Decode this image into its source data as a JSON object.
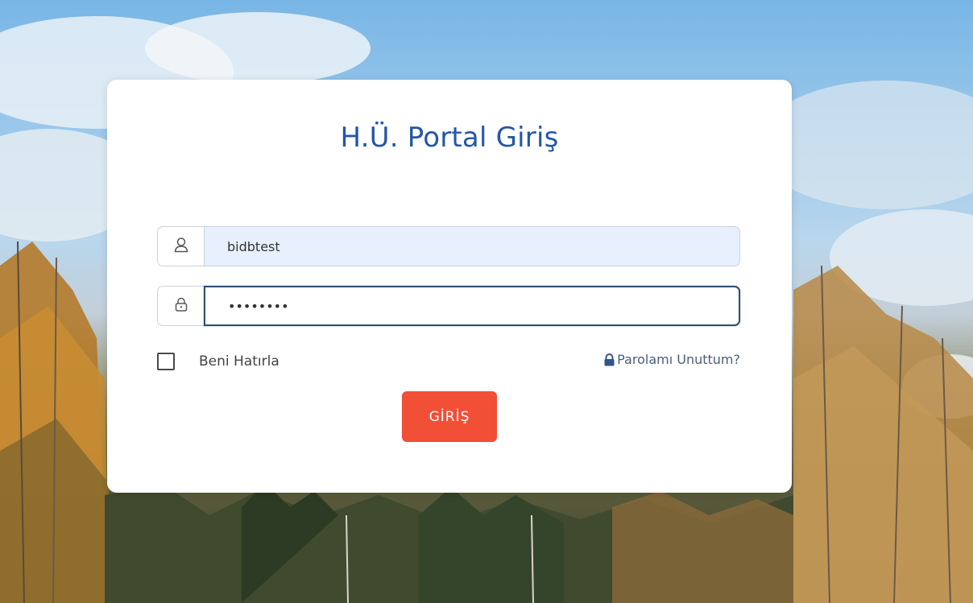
{
  "login": {
    "title": "H.Ü. Portal Giriş",
    "username": {
      "value": "bidbtest",
      "icon": "user-icon"
    },
    "password": {
      "value": "••••••••",
      "icon": "lock-icon"
    },
    "remember_me": {
      "label": "Beni Hatırla",
      "checked": false
    },
    "forgot_password": {
      "label": "Parolamı Unuttum?",
      "icon": "lock-icon"
    },
    "submit_label": "GİRİŞ"
  },
  "colors": {
    "title": "#2557a7",
    "button": "#f24f37",
    "link": "#4a5f7a",
    "focused_border": "#2f4f72",
    "autofill_bg": "#e8f0fe"
  }
}
